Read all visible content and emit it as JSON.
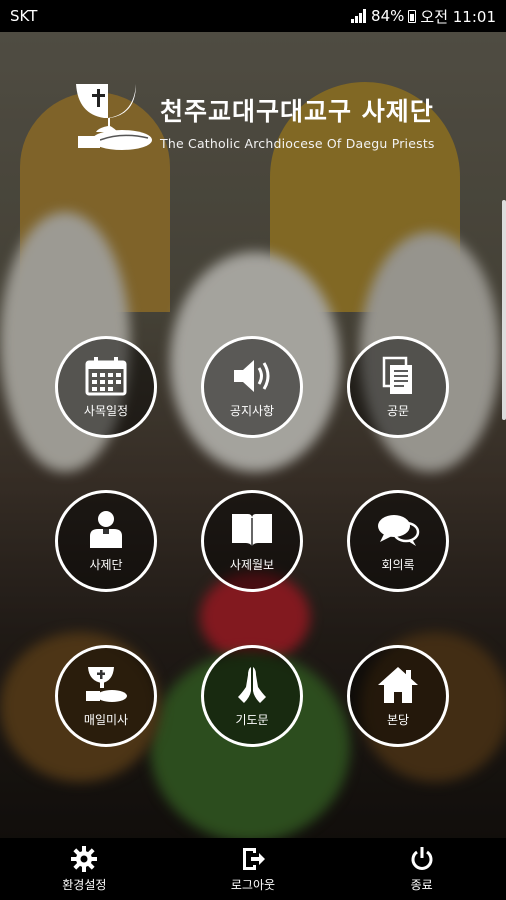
{
  "status": {
    "carrier": "SKT",
    "battery": "84%",
    "time": "오전 11:01"
  },
  "header": {
    "title": "천주교대구대교구 사제단",
    "subtitle": "The Catholic Archdiocese Of Daegu Priests"
  },
  "menu": {
    "items": [
      {
        "label": "사목일정",
        "icon": "calendar-icon"
      },
      {
        "label": "공지사항",
        "icon": "speaker-icon"
      },
      {
        "label": "공문",
        "icon": "documents-icon"
      },
      {
        "label": "사제단",
        "icon": "person-icon"
      },
      {
        "label": "사제월보",
        "icon": "book-icon"
      },
      {
        "label": "회의록",
        "icon": "chat-icon"
      },
      {
        "label": "매일미사",
        "icon": "chalice-icon"
      },
      {
        "label": "기도문",
        "icon": "praying-hands-icon"
      },
      {
        "label": "본당",
        "icon": "house-icon"
      }
    ]
  },
  "bottom": {
    "settings_label": "환경설정",
    "logout_label": "로그아웃",
    "exit_label": "종료"
  }
}
